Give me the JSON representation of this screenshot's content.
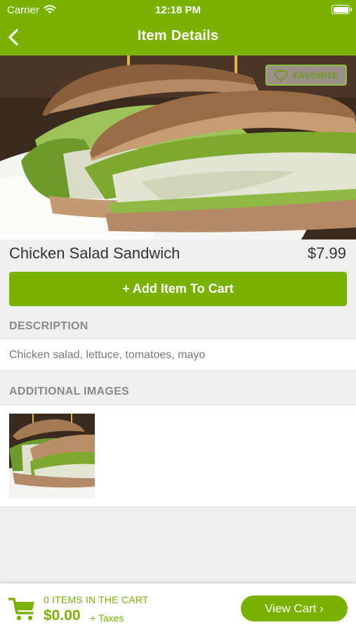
{
  "status_bar": {
    "carrier": "Carrier",
    "time": "12:18 PM",
    "battery_level": 1.0
  },
  "nav": {
    "title": "Item Details",
    "back_icon": "chevron-left-icon"
  },
  "hero": {
    "image_subject": "chicken salad sandwich photo",
    "favorite_label": "FAVORITE",
    "favorite_icon": "heart-icon"
  },
  "item": {
    "name": "Chicken Salad Sandwich",
    "price": "$7.99"
  },
  "add_button": {
    "icon": "plus-icon",
    "label": "Add Item To Cart"
  },
  "description": {
    "heading": "DESCRIPTION",
    "text": "Chicken salad, lettuce, tomatoes, mayo"
  },
  "additional_images": {
    "heading": "ADDITIONAL IMAGES"
  },
  "cart_bar": {
    "icon": "cart-icon",
    "items_label": "0 ITEMS IN THE CART",
    "total": "$0.00",
    "taxes": "+ Taxes",
    "view_cart_label": "View Cart"
  },
  "colors": {
    "brand_green": "#79b200",
    "favorite_border": "#8fbd44"
  }
}
